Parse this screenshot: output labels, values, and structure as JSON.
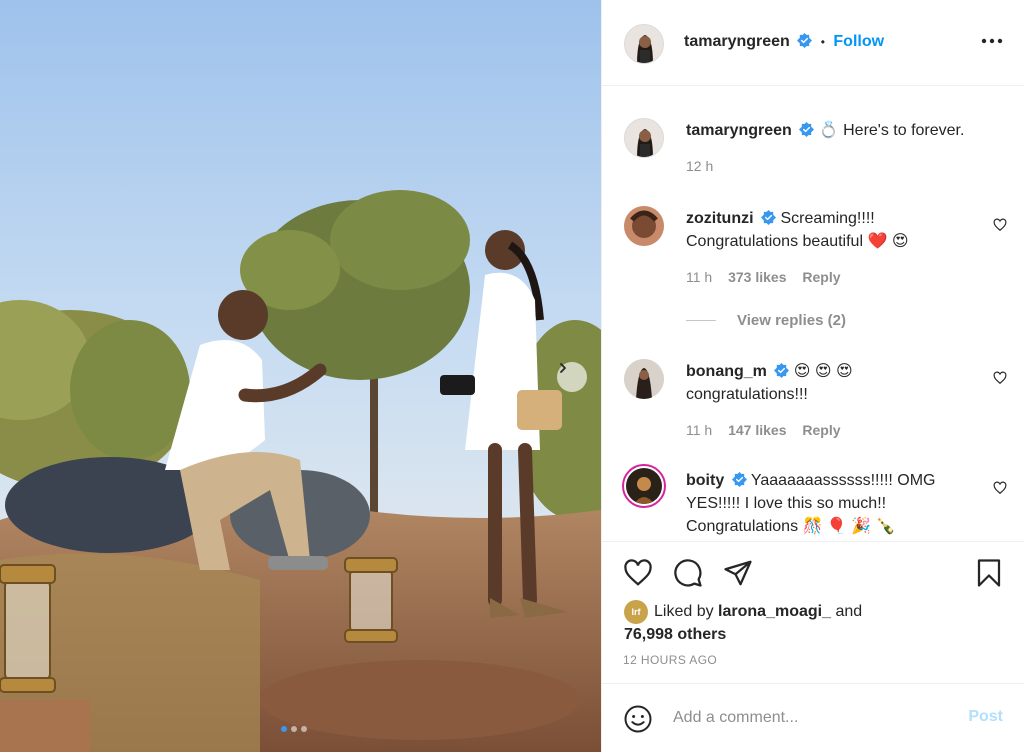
{
  "post": {
    "author": "tamaryngreen",
    "follow_label": "Follow",
    "separator": "•",
    "more_icon": "ellipsis-icon",
    "verified_color": "#3897f0",
    "accent": "#0095f6",
    "carousel": {
      "total_slides": 3,
      "active_slide": 1
    }
  },
  "caption": {
    "username": "tamaryngreen",
    "emoji": "💍",
    "text": "Here's to forever.",
    "time": "12 h"
  },
  "comments": [
    {
      "username": "zozitunzi",
      "line1": "Screaming!!!!",
      "line2": "Congratulations beautiful ❤️ 😍",
      "time": "11 h",
      "likes": "373 likes",
      "reply": "Reply",
      "view_replies": "View replies (2)"
    },
    {
      "username": "bonang_m",
      "line1": "😍 😍 😍",
      "line2": "congratulations!!!",
      "time": "11 h",
      "likes": "147 likes",
      "reply": "Reply"
    },
    {
      "username": "boity",
      "line1": "Yaaaaaaassssss!!!!! OMG",
      "line2": "YES!!!!! I love this so much!!",
      "line3": "Congratulations 🎊 🎈 🎉 🍾"
    }
  ],
  "actions": {
    "like_icon": "heart-icon",
    "comment_icon": "comment-icon",
    "share_icon": "send-icon",
    "save_icon": "bookmark-icon",
    "liked_by_prefix": "Liked by",
    "liked_by_user": "larona_moagi_",
    "liked_by_and": "and",
    "liked_by_others": "76,998 others",
    "liked_avatar_text": "lrf",
    "timestamp": "12 HOURS AGO"
  },
  "add_comment": {
    "placeholder": "Add a comment...",
    "post_label": "Post",
    "emoji_icon": "smiley-icon"
  }
}
